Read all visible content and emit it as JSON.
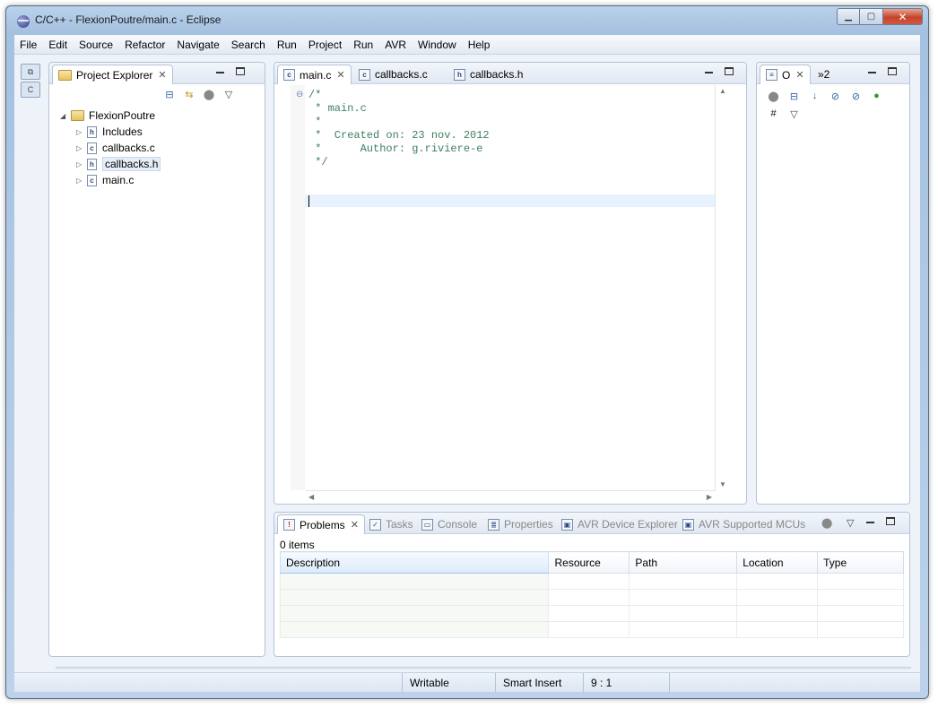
{
  "window": {
    "title": "C/C++ - FlexionPoutre/main.c - Eclipse"
  },
  "menu": [
    "File",
    "Edit",
    "Source",
    "Refactor",
    "Navigate",
    "Search",
    "Run",
    "Project",
    "Run",
    "AVR",
    "Window",
    "Help"
  ],
  "project_explorer": {
    "tab_label": "Project Explorer",
    "tree": {
      "project": "FlexionPoutre",
      "children": [
        "Includes",
        "callbacks.c",
        "callbacks.h",
        "main.c"
      ]
    }
  },
  "editor": {
    "tabs": [
      "main.c",
      "callbacks.c",
      "callbacks.h"
    ],
    "code_lines": [
      "/*",
      " * main.c",
      " *",
      " *  Created on: 23 nov. 2012",
      " *      Author: g.riviere-e",
      " */"
    ]
  },
  "outline": {
    "tab_label": "O",
    "overflow_label": "»2"
  },
  "bottom": {
    "tabs": [
      "Problems",
      "Tasks",
      "Console",
      "Properties",
      "AVR Device Explorer",
      "AVR Supported MCUs"
    ],
    "items_count": "0 items",
    "columns": [
      "Description",
      "Resource",
      "Path",
      "Location",
      "Type"
    ]
  },
  "status": {
    "writable": "Writable",
    "insert_mode": "Smart Insert",
    "position": "9 : 1"
  }
}
